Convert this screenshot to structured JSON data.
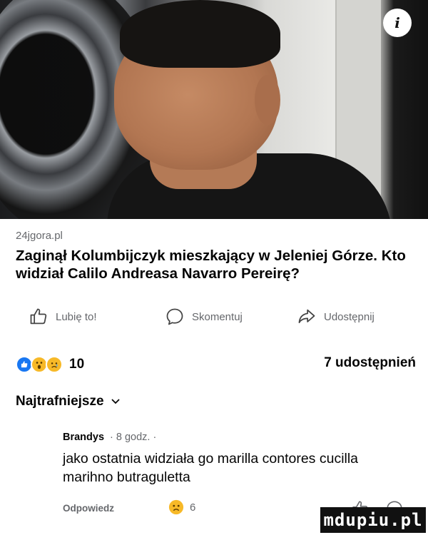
{
  "post": {
    "source": "24jgora.pl",
    "headline": "Zaginął Kolumbijczyk mieszkający w Jeleniej Górze. Kto widział Calilo Andreasa Navarro Pereirę?"
  },
  "actions": {
    "like_label": "Lubię to!",
    "comment_label": "Skomentuj",
    "share_label": "Udostępnij"
  },
  "reactions": {
    "types": [
      "like-icon",
      "wow-icon",
      "sad-icon"
    ],
    "count": "10",
    "shares": "7 udostępnień"
  },
  "comments": {
    "sort_label": "Najtrafniejsze",
    "items": [
      {
        "author": "Brandys",
        "time": "· 8 godz. ·",
        "text": "jako ostatnia widziała go  marilla contores cucilla marihno butraguletta",
        "reply_label": "Odpowiedz",
        "reaction_count": "6"
      }
    ]
  },
  "watermark": "mdupiu.pl",
  "colors": {
    "accent": "#1877f2",
    "secondary_text": "#65676b",
    "text": "#050505"
  }
}
